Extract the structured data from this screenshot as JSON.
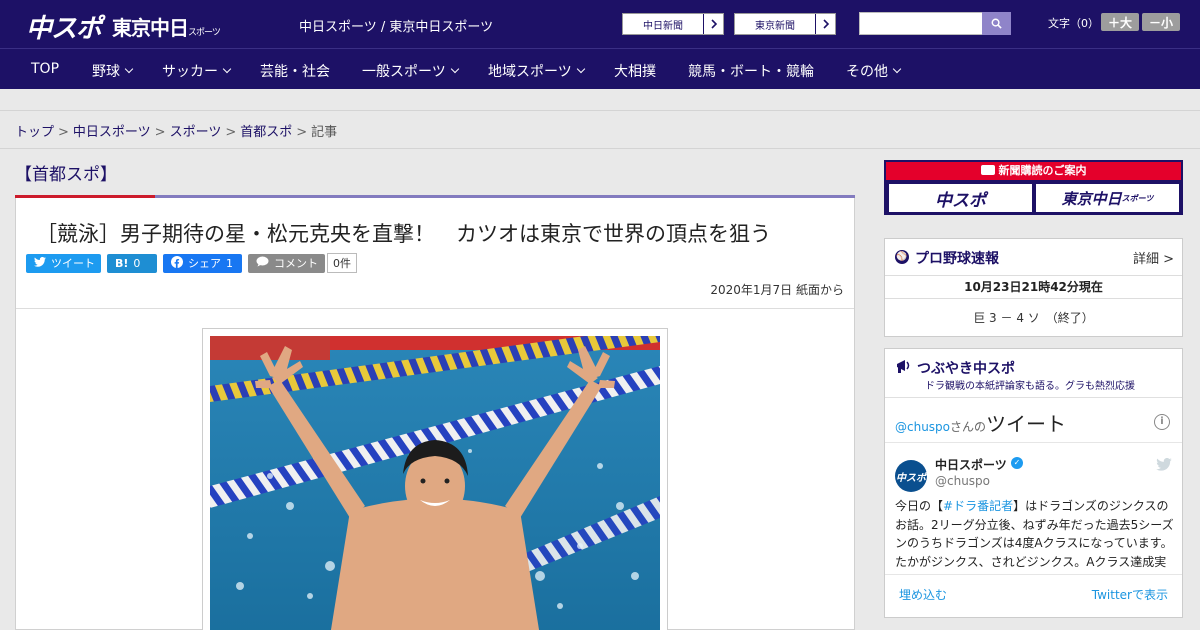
{
  "header": {
    "logo_main": "中スポ",
    "logo_sub": "東京中日",
    "logo_sub_small": "スポーツ",
    "site_title": "中日スポーツ / 東京中日スポーツ",
    "ext_links": [
      "中日新聞",
      "東京新聞"
    ],
    "fontsize_label": "文字（0）",
    "fontsize_up": "＋大",
    "fontsize_down": "－小"
  },
  "nav": {
    "items": [
      {
        "label": "TOP",
        "chevron": false
      },
      {
        "label": "野球",
        "chevron": true
      },
      {
        "label": "サッカー",
        "chevron": true
      },
      {
        "label": "芸能・社会",
        "chevron": false
      },
      {
        "label": "一般スポーツ",
        "chevron": true
      },
      {
        "label": "地域スポーツ",
        "chevron": true
      },
      {
        "label": "大相撲",
        "chevron": false
      },
      {
        "label": "競馬・ボート・競輪",
        "chevron": false
      },
      {
        "label": "その他",
        "chevron": true
      }
    ]
  },
  "breadcrumb": {
    "items": [
      "トップ",
      "中日スポーツ",
      "スポーツ",
      "首都スポ"
    ],
    "current": "記事",
    "separator": ">"
  },
  "section": {
    "title": "【首都スポ】"
  },
  "article": {
    "title": "［競泳］男子期待の星・松元克央を直撃！　カツオは東京で世界の頂点を狙う",
    "share": {
      "tweet_label": "ツイート",
      "hatena_label": "B!",
      "hatena_count": "0",
      "facebook_label": "シェア",
      "facebook_count": "1",
      "comment_label": "コメント",
      "comment_count": "0件"
    },
    "date": "2020年1月7日 紙面から"
  },
  "sidebar": {
    "ad": {
      "banner": "新聞購読のご案内",
      "left": "中スポ",
      "right": "東京中日",
      "right_small": "スポーツ"
    },
    "baseball": {
      "title": "プロ野球速報",
      "detail_link": "詳細 >",
      "updated": "10月23日21時42分現在",
      "score": "巨 3 － 4 ソ　（終了）"
    },
    "tweets": {
      "title": "つぶやき中スポ",
      "subtitle": "ドラ観戦の本紙評論家も語る。グラも熱烈応援",
      "account_prefix": "@chuspo",
      "account_suffix": "さんの",
      "header_big": "ツイート",
      "user_name": "中日スポーツ",
      "user_handle": "@chuspo",
      "avatar_text": "中スポ",
      "text_before": "今日の【",
      "hashtag": "#ドラ番記者",
      "text_after": "】はドラゴンズのジンクスのお話。2リーグ分立後、ねずみ年だった過去5シーズンのうちドラゴンズは4度Aクラスになっています。たかがジンクス、されどジンクス。Aクラス達成実",
      "embed_link": "埋め込む",
      "view_link": "Twitterで表示"
    }
  },
  "colors": {
    "brand": "#1d1166",
    "accent_red": "#cc1b2b",
    "twitter": "#1d9bf0",
    "facebook": "#1877f2"
  }
}
